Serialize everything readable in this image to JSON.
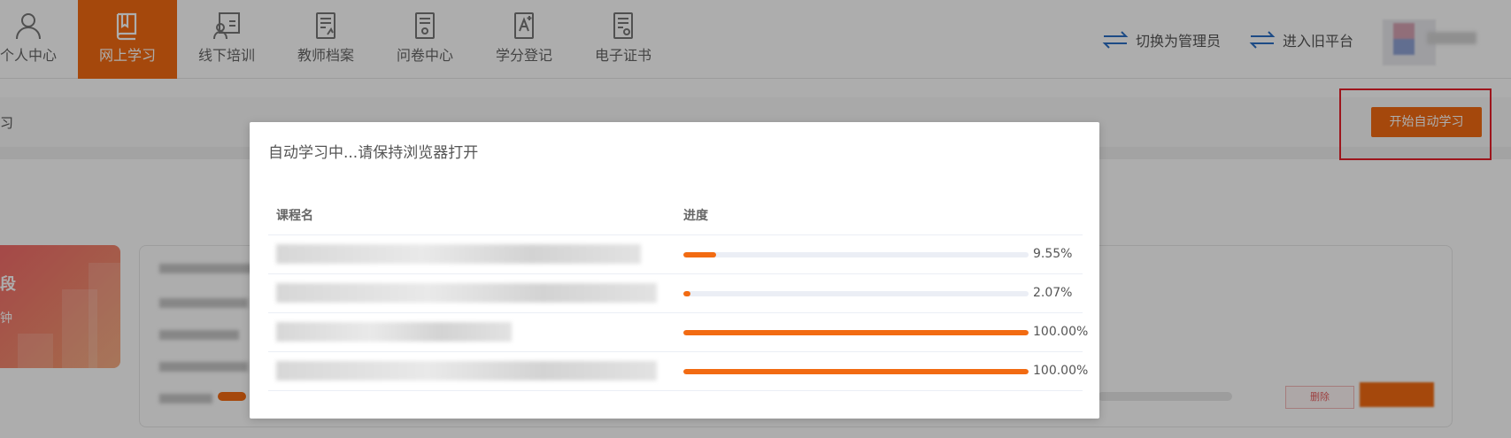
{
  "topnav": {
    "items": [
      {
        "label": "个人中心",
        "icon": "person-icon"
      },
      {
        "label": "网上学习",
        "icon": "book-icon",
        "active": true
      },
      {
        "label": "线下培训",
        "icon": "trainer-board-icon"
      },
      {
        "label": "教师档案",
        "icon": "document-icon"
      },
      {
        "label": "问卷中心",
        "icon": "questionnaire-icon"
      },
      {
        "label": "学分登记",
        "icon": "credit-icon"
      },
      {
        "label": "电子证书",
        "icon": "certificate-icon"
      }
    ],
    "switch_admin": "切换为管理员",
    "old_platform": "进入旧平台"
  },
  "page": {
    "subbar_text": "习",
    "auto_study_button": "开始自动学习",
    "card_title": "段",
    "card_sub": "钟",
    "delete_button": "删除"
  },
  "modal": {
    "title": "自动学习中...请保持浏览器打开",
    "col_name": "课程名",
    "col_progress": "进度",
    "rows": [
      {
        "progress": 9.55,
        "progress_label": "9.55%"
      },
      {
        "progress": 2.07,
        "progress_label": "2.07%"
      },
      {
        "progress": 100,
        "progress_label": "100.00%"
      },
      {
        "progress": 100,
        "progress_label": "100.00%"
      }
    ]
  },
  "colors": {
    "accent": "#f36b12",
    "highlight_frame": "#e8202a"
  }
}
